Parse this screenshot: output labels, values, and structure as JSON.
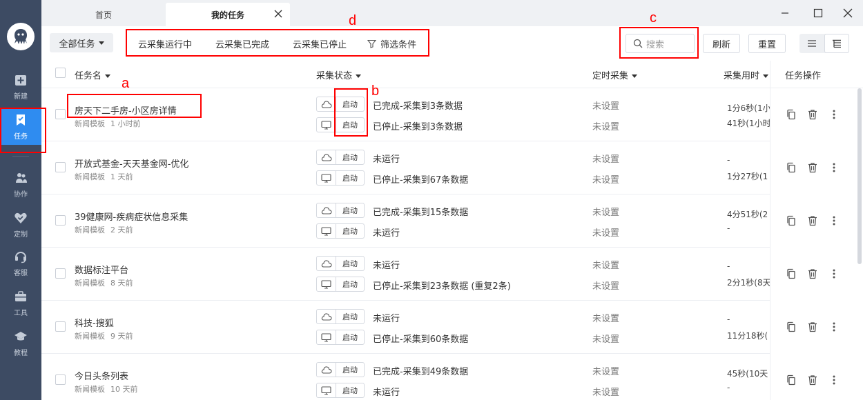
{
  "tabs": {
    "home": "首页",
    "my_tasks": "我的任务"
  },
  "sidebar": {
    "items": [
      {
        "label": "新建",
        "icon": "plus-square-icon"
      },
      {
        "label": "任务",
        "icon": "bookmark-task-icon"
      },
      {
        "label": "协作",
        "icon": "users-icon"
      },
      {
        "label": "定制",
        "icon": "heart-badge-icon"
      },
      {
        "label": "客服",
        "icon": "headset-icon"
      },
      {
        "label": "工具",
        "icon": "toolbox-icon"
      },
      {
        "label": "教程",
        "icon": "graduation-cap-icon"
      }
    ]
  },
  "toolbar": {
    "all_tasks": "全部任务",
    "filters": [
      "云采集运行中",
      "云采集已完成",
      "云采集已停止"
    ],
    "filter_conditions": "筛选条件",
    "search_placeholder": "搜索",
    "refresh": "刷新",
    "reset": "重置"
  },
  "table": {
    "headers": {
      "name": "任务名",
      "status": "采集状态",
      "schedule": "定时采集",
      "duration": "采集用时",
      "actions": "任务操作"
    },
    "start_label": "启动",
    "rows": [
      {
        "name": "房天下二手房-小区房详情",
        "template": "新闻模板",
        "age": "1 小时前",
        "cloud_status": "已完成-采集到3条数据",
        "local_status": "已停止-采集到3条数据",
        "cloud_schedule": "未设置",
        "local_schedule": "未设置",
        "cloud_time": "1分6秒(1小",
        "local_time": "41秒(1小时"
      },
      {
        "name": "开放式基金-天天基金网-优化",
        "template": "新闻模板",
        "age": "1 天前",
        "cloud_status": "未运行",
        "local_status": "已停止-采集到67条数据",
        "cloud_schedule": "未设置",
        "local_schedule": "未设置",
        "cloud_time": "-",
        "local_time": "1分27秒(1"
      },
      {
        "name": "39健康网-疾病症状信息采集",
        "template": "新闻模板",
        "age": "2 天前",
        "cloud_status": "已完成-采集到15条数据",
        "local_status": "未运行",
        "cloud_schedule": "未设置",
        "local_schedule": "未设置",
        "cloud_time": "4分51秒(2",
        "local_time": "-"
      },
      {
        "name": "数据标注平台",
        "template": "新闻模板",
        "age": "8 天前",
        "cloud_status": "未运行",
        "local_status": "已停止-采集到23条数据 (重复2条)",
        "cloud_schedule": "未设置",
        "local_schedule": "未设置",
        "cloud_time": "-",
        "local_time": "2分1秒(8天"
      },
      {
        "name": "科技-搜狐",
        "template": "新闻模板",
        "age": "9 天前",
        "cloud_status": "未运行",
        "local_status": "已停止-采集到60条数据",
        "cloud_schedule": "未设置",
        "local_schedule": "未设置",
        "cloud_time": "-",
        "local_time": "11分18秒("
      },
      {
        "name": "今日头条列表",
        "template": "新闻模板",
        "age": "10 天前",
        "cloud_status": "已完成-采集到49条数据",
        "local_status": "未运行",
        "cloud_schedule": "未设置",
        "local_schedule": "未设置",
        "cloud_time": "45秒(10天",
        "local_time": "-"
      }
    ]
  },
  "annotations": {
    "a": "a",
    "b": "b",
    "c": "c",
    "d": "d",
    "color": "#ff0000"
  },
  "colors": {
    "sidebar": "#3d4b63",
    "active": "#2f8cf0"
  }
}
